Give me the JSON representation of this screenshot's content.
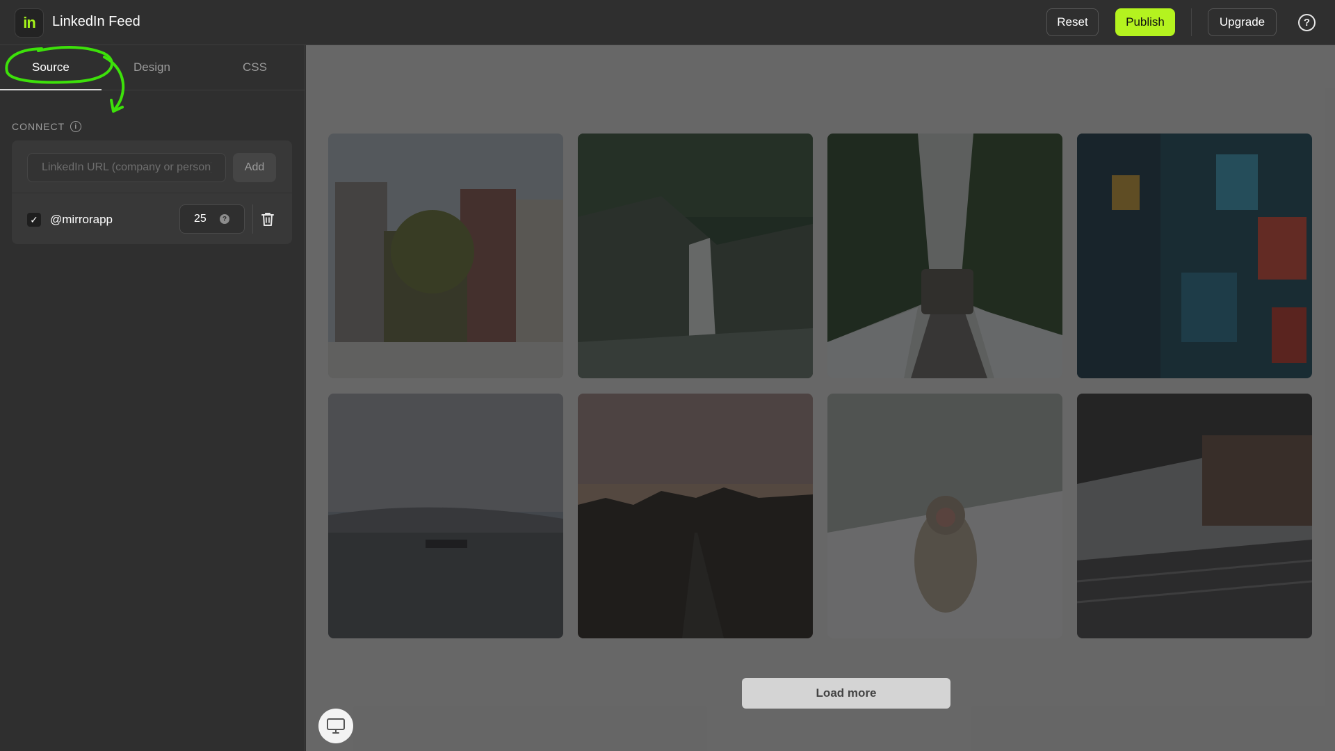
{
  "header": {
    "logo_text": "in",
    "title": "LinkedIn Feed",
    "reset_label": "Reset",
    "publish_label": "Publish",
    "upgrade_label": "Upgrade",
    "help_icon": "help-icon",
    "accent_color": "#b4f31f"
  },
  "sidebar": {
    "tabs": [
      {
        "label": "Source",
        "active": true
      },
      {
        "label": "Design",
        "active": false
      },
      {
        "label": "CSS",
        "active": false
      }
    ],
    "connect": {
      "section_label": "CONNECT",
      "url_placeholder": "LinkedIn URL (company or person)",
      "add_label": "Add",
      "source": {
        "checked": true,
        "handle": "@mirrorapp",
        "count": "25"
      }
    }
  },
  "preview": {
    "images": [
      {
        "icon": "townhouses-photo"
      },
      {
        "icon": "waterfall-photo"
      },
      {
        "icon": "truck-forest-road-photo"
      },
      {
        "icon": "neon-city-photo"
      },
      {
        "icon": "harbor-dusk-photo"
      },
      {
        "icon": "desert-road-sunset-photo"
      },
      {
        "icon": "snow-monkey-photo"
      },
      {
        "icon": "train-station-photo"
      }
    ],
    "load_more_label": "Load more"
  }
}
